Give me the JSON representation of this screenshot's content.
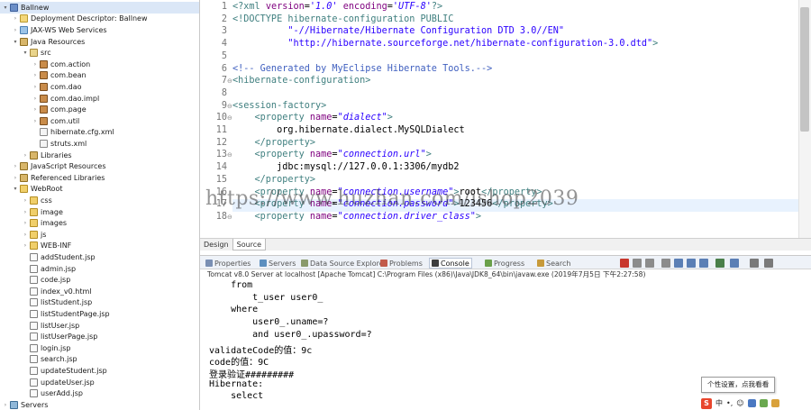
{
  "explorer": {
    "items": [
      {
        "label": "Ballnew",
        "depth": 0,
        "twisty": "▾",
        "icon": "project-icon",
        "selected": true
      },
      {
        "label": "Deployment Descriptor: Ballnew",
        "depth": 1,
        "twisty": "›",
        "icon": "deployment-descriptor-icon"
      },
      {
        "label": "JAX-WS Web Services",
        "depth": 1,
        "twisty": "›",
        "icon": "web-services-icon"
      },
      {
        "label": "Java Resources",
        "depth": 1,
        "twisty": "▾",
        "icon": "java-resources-icon"
      },
      {
        "label": "src",
        "depth": 2,
        "twisty": "▾",
        "icon": "source-folder-icon"
      },
      {
        "label": "com.action",
        "depth": 3,
        "twisty": "›",
        "icon": "package-icon"
      },
      {
        "label": "com.bean",
        "depth": 3,
        "twisty": "›",
        "icon": "package-icon"
      },
      {
        "label": "com.dao",
        "depth": 3,
        "twisty": "›",
        "icon": "package-icon"
      },
      {
        "label": "com.dao.impl",
        "depth": 3,
        "twisty": "›",
        "icon": "package-icon"
      },
      {
        "label": "com.page",
        "depth": 3,
        "twisty": "›",
        "icon": "package-icon"
      },
      {
        "label": "com.util",
        "depth": 3,
        "twisty": "›",
        "icon": "package-icon"
      },
      {
        "label": "hibernate.cfg.xml",
        "depth": 3,
        "twisty": "",
        "icon": "xml-file-icon"
      },
      {
        "label": "struts.xml",
        "depth": 3,
        "twisty": "",
        "icon": "xml-file-icon"
      },
      {
        "label": "Libraries",
        "depth": 2,
        "twisty": "›",
        "icon": "libraries-icon"
      },
      {
        "label": "JavaScript Resources",
        "depth": 1,
        "twisty": "›",
        "icon": "javascript-resources-icon"
      },
      {
        "label": "Referenced Libraries",
        "depth": 1,
        "twisty": "›",
        "icon": "referenced-libraries-icon"
      },
      {
        "label": "WebRoot",
        "depth": 1,
        "twisty": "▾",
        "icon": "webroot-folder-icon"
      },
      {
        "label": "css",
        "depth": 2,
        "twisty": "›",
        "icon": "folder-icon"
      },
      {
        "label": "image",
        "depth": 2,
        "twisty": "›",
        "icon": "folder-icon"
      },
      {
        "label": "images",
        "depth": 2,
        "twisty": "›",
        "icon": "folder-icon"
      },
      {
        "label": "js",
        "depth": 2,
        "twisty": "›",
        "icon": "folder-icon"
      },
      {
        "label": "WEB-INF",
        "depth": 2,
        "twisty": "›",
        "icon": "folder-icon"
      },
      {
        "label": "addStudent.jsp",
        "depth": 2,
        "twisty": "",
        "icon": "jsp-file-icon"
      },
      {
        "label": "admin.jsp",
        "depth": 2,
        "twisty": "",
        "icon": "jsp-file-icon"
      },
      {
        "label": "code.jsp",
        "depth": 2,
        "twisty": "",
        "icon": "jsp-file-icon"
      },
      {
        "label": "index_v0.html",
        "depth": 2,
        "twisty": "",
        "icon": "html-file-icon"
      },
      {
        "label": "listStudent.jsp",
        "depth": 2,
        "twisty": "",
        "icon": "jsp-file-icon"
      },
      {
        "label": "listStudentPage.jsp",
        "depth": 2,
        "twisty": "",
        "icon": "jsp-file-icon"
      },
      {
        "label": "listUser.jsp",
        "depth": 2,
        "twisty": "",
        "icon": "jsp-file-icon"
      },
      {
        "label": "listUserPage.jsp",
        "depth": 2,
        "twisty": "",
        "icon": "jsp-file-icon"
      },
      {
        "label": "login.jsp",
        "depth": 2,
        "twisty": "",
        "icon": "jsp-file-icon"
      },
      {
        "label": "search.jsp",
        "depth": 2,
        "twisty": "",
        "icon": "jsp-file-icon"
      },
      {
        "label": "updateStudent.jsp",
        "depth": 2,
        "twisty": "",
        "icon": "jsp-file-icon"
      },
      {
        "label": "updateUser.jsp",
        "depth": 2,
        "twisty": "",
        "icon": "jsp-file-icon"
      },
      {
        "label": "userAdd.jsp",
        "depth": 2,
        "twisty": "",
        "icon": "jsp-file-icon"
      },
      {
        "label": "Servers",
        "depth": 0,
        "twisty": "›",
        "icon": "servers-icon"
      }
    ]
  },
  "editor": {
    "highlighted_line": 17,
    "lines": [
      {
        "n": "1",
        "fold": "",
        "tokens": [
          {
            "c": "c-tag",
            "t": "<?xml "
          },
          {
            "c": "c-attr",
            "t": "version"
          },
          {
            "c": "c-txt",
            "t": "="
          },
          {
            "c": "c-val",
            "t": "'1.0'"
          },
          {
            "c": "c-txt",
            "t": " "
          },
          {
            "c": "c-attr",
            "t": "encoding"
          },
          {
            "c": "c-txt",
            "t": "="
          },
          {
            "c": "c-val",
            "t": "'UTF-8'"
          },
          {
            "c": "c-tag",
            "t": "?>"
          }
        ]
      },
      {
        "n": "2",
        "fold": "",
        "tokens": [
          {
            "c": "c-tag",
            "t": "<!DOCTYPE hibernate-configuration PUBLIC"
          }
        ]
      },
      {
        "n": "3",
        "fold": "",
        "tokens": [
          {
            "c": "c-str",
            "t": "          \"-//Hibernate/Hibernate Configuration DTD 3.0//EN\""
          }
        ]
      },
      {
        "n": "4",
        "fold": "",
        "tokens": [
          {
            "c": "c-str",
            "t": "          \"http://hibernate.sourceforge.net/hibernate-configuration-3.0.dtd\""
          },
          {
            "c": "c-tag",
            "t": ">"
          }
        ]
      },
      {
        "n": "5",
        "fold": "",
        "tokens": []
      },
      {
        "n": "6",
        "fold": "",
        "tokens": [
          {
            "c": "c-comm",
            "t": "<!-- Generated by MyEclipse Hibernate Tools.-->"
          }
        ]
      },
      {
        "n": "7",
        "fold": "⊖",
        "tokens": [
          {
            "c": "c-tag",
            "t": "<hibernate-configuration>"
          }
        ]
      },
      {
        "n": "8",
        "fold": "",
        "tokens": []
      },
      {
        "n": "9",
        "fold": "⊖",
        "tokens": [
          {
            "c": "c-tag",
            "t": "<session-factory>"
          }
        ]
      },
      {
        "n": "10",
        "fold": "⊖",
        "tokens": [
          {
            "c": "c-tag",
            "t": "    <property "
          },
          {
            "c": "c-attr",
            "t": "name"
          },
          {
            "c": "c-txt",
            "t": "="
          },
          {
            "c": "c-val",
            "t": "\"dialect\""
          },
          {
            "c": "c-tag",
            "t": ">"
          }
        ]
      },
      {
        "n": "11",
        "fold": "",
        "tokens": [
          {
            "c": "c-txt",
            "t": "        org.hibernate.dialect.MySQLDialect"
          }
        ]
      },
      {
        "n": "12",
        "fold": "",
        "tokens": [
          {
            "c": "c-tag",
            "t": "    </property>"
          }
        ]
      },
      {
        "n": "13",
        "fold": "⊖",
        "tokens": [
          {
            "c": "c-tag",
            "t": "    <property "
          },
          {
            "c": "c-attr",
            "t": "name"
          },
          {
            "c": "c-txt",
            "t": "="
          },
          {
            "c": "c-val",
            "t": "\"connection.url\""
          },
          {
            "c": "c-tag",
            "t": ">"
          }
        ]
      },
      {
        "n": "14",
        "fold": "",
        "tokens": [
          {
            "c": "c-txt",
            "t": "        jdbc:mysql://127.0.0.1:3306/mydb2"
          }
        ]
      },
      {
        "n": "15",
        "fold": "",
        "tokens": [
          {
            "c": "c-tag",
            "t": "    </property>"
          }
        ]
      },
      {
        "n": "16",
        "fold": "",
        "tokens": [
          {
            "c": "c-tag",
            "t": "    <property "
          },
          {
            "c": "c-attr",
            "t": "name"
          },
          {
            "c": "c-txt",
            "t": "="
          },
          {
            "c": "c-val",
            "t": "\"connection.username\""
          },
          {
            "c": "c-tag",
            "t": ">"
          },
          {
            "c": "c-txt",
            "t": "root"
          },
          {
            "c": "c-tag",
            "t": "</property>"
          }
        ]
      },
      {
        "n": "17",
        "fold": "",
        "tokens": [
          {
            "c": "c-tag",
            "t": "    <property "
          },
          {
            "c": "c-attr",
            "t": "name"
          },
          {
            "c": "c-txt",
            "t": "="
          },
          {
            "c": "c-val",
            "t": "\"connection.password\""
          },
          {
            "c": "c-tag",
            "t": ">"
          },
          {
            "c": "c-txt",
            "t": "123456"
          },
          {
            "c": "c-tag",
            "t": "</property>"
          }
        ]
      },
      {
        "n": "18",
        "fold": "⊖",
        "tokens": [
          {
            "c": "c-tag",
            "t": "    <property "
          },
          {
            "c": "c-attr",
            "t": "name"
          },
          {
            "c": "c-txt",
            "t": "="
          },
          {
            "c": "c-val",
            "t": "\"connection.driver_class\""
          },
          {
            "c": "c-tag",
            "t": ">"
          }
        ]
      }
    ]
  },
  "watermark": "https://www.huzhan.com/ishop2039",
  "design_tabs": [
    "Design",
    "Source"
  ],
  "views": {
    "tabs": [
      {
        "label": "Properties",
        "icon": "properties-icon",
        "active": false
      },
      {
        "label": "Servers",
        "icon": "servers-view-icon",
        "active": false
      },
      {
        "label": "Data Source Explorer",
        "icon": "data-source-explorer-icon",
        "active": false
      },
      {
        "label": "Problems",
        "icon": "problems-icon",
        "active": false
      },
      {
        "label": "Console",
        "icon": "console-icon",
        "active": true
      },
      {
        "label": "Progress",
        "icon": "progress-icon",
        "active": false
      },
      {
        "label": "Search",
        "icon": "search-icon",
        "active": false
      }
    ],
    "toolbar_icons": [
      "terminate-icon",
      "remove-launch-icon",
      "remove-all-icon",
      "clear-console-icon",
      "scroll-lock-icon",
      "word-wrap-icon",
      "pin-console-icon",
      "display-console-icon",
      "open-console-icon",
      "minimize-icon",
      "maximize-icon"
    ]
  },
  "console": {
    "title": "Tomcat v8.0 Server at localhost [Apache Tomcat] C:\\Program Files (x86)\\Java\\JDK8_64\\bin\\javaw.exe (2019年7月5日 下午2:27:58)",
    "lines": [
      "    from",
      "        t_user user0_",
      "    where",
      "        user0_.uname=?",
      "        and user0_.upassword=?",
      "validateCode的值：9c",
      "code的值：9C",
      "登录验证#########",
      "Hibernate:",
      "    select"
    ]
  },
  "tooltip": "个性设置，点我看看",
  "ime": {
    "logo": "S",
    "mode": "中",
    "punct": "•,",
    "extra": "☺"
  }
}
